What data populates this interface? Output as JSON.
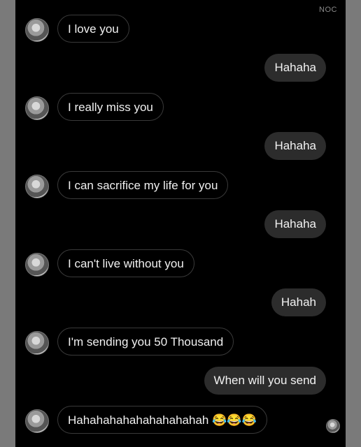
{
  "watermark": "NOC",
  "messages": [
    {
      "side": "incoming",
      "text": "I love you"
    },
    {
      "side": "outgoing",
      "text": "Hahaha"
    },
    {
      "side": "incoming",
      "text": "I really miss you"
    },
    {
      "side": "outgoing",
      "text": "Hahaha"
    },
    {
      "side": "incoming",
      "text": "I can sacrifice my life for you"
    },
    {
      "side": "outgoing",
      "text": "Hahaha"
    },
    {
      "side": "incoming",
      "text": "I can't live without you"
    },
    {
      "side": "outgoing",
      "text": "Hahah"
    },
    {
      "side": "incoming",
      "text": "I'm sending you 50 Thousand"
    },
    {
      "side": "outgoing",
      "text": "When will you send"
    },
    {
      "side": "incoming",
      "text": "Hahahahahahahahahahah",
      "emoji": "😂😂😂"
    }
  ]
}
